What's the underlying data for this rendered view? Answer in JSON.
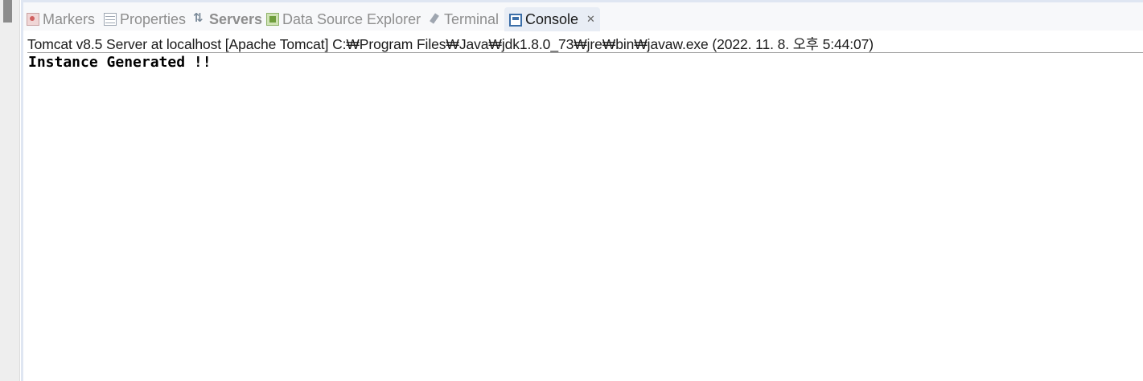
{
  "tabs": [
    {
      "label": "Markers",
      "icon": "markers-icon",
      "active": false
    },
    {
      "label": "Properties",
      "icon": "properties-icon",
      "active": false
    },
    {
      "label": "Servers",
      "icon": "servers-icon",
      "active": false
    },
    {
      "label": "Data Source Explorer",
      "icon": "data-source-icon",
      "active": false
    },
    {
      "label": "Terminal",
      "icon": "terminal-icon",
      "active": false
    },
    {
      "label": "Console",
      "icon": "console-icon",
      "active": true,
      "close": "✕"
    }
  ],
  "console": {
    "header": "Tomcat v8.5 Server at localhost [Apache Tomcat] C:₩Program Files₩Java₩jdk1.8.0_73₩jre₩bin₩javaw.exe (2022. 11. 8. 오후 5:44:07)",
    "output": "Instance Generated !!"
  },
  "colors": {
    "tabbar_bg": "#f7f8fa",
    "active_tab_bg": "#e8edf5",
    "inactive_tab_text": "#8e8e8e",
    "text": "#1a1a1a"
  }
}
